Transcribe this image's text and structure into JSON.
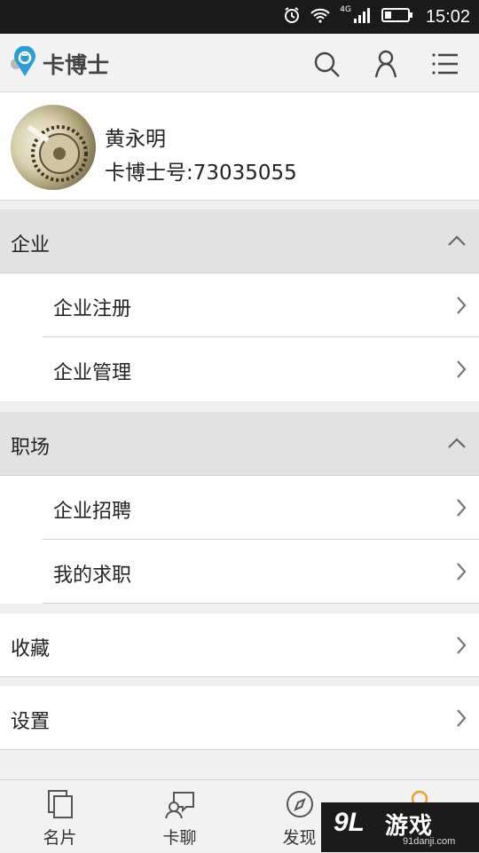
{
  "status_bar": {
    "network": "4G",
    "time": "15:02"
  },
  "app_bar": {
    "title": "卡博士",
    "icons": [
      "logo-icon",
      "search-icon",
      "user-icon",
      "menu-icon"
    ]
  },
  "profile": {
    "name": "黄永明",
    "id_text": "卡博士号:73035055"
  },
  "sections": [
    {
      "title": "企业",
      "expanded": true,
      "items": [
        "企业注册",
        "企业管理"
      ]
    },
    {
      "title": "职场",
      "expanded": true,
      "items": [
        "企业招聘",
        "我的求职"
      ]
    }
  ],
  "top_items": [
    "收藏",
    "设置"
  ],
  "bottom_nav": [
    {
      "label": "名片",
      "icon": "card-icon"
    },
    {
      "label": "卡聊",
      "icon": "chat-icon"
    },
    {
      "label": "发现",
      "icon": "compass-icon"
    },
    {
      "label": "",
      "icon": "me-icon"
    }
  ],
  "watermark": {
    "brand": "游戏",
    "logo_text": "9L",
    "url": "91danji.com"
  },
  "colors": {
    "accent_blue": "#2a9fd6",
    "status_bar_bg": "#1a1a1a",
    "section_bg": "#e2e2e2",
    "active_tab": "#f0a020"
  }
}
